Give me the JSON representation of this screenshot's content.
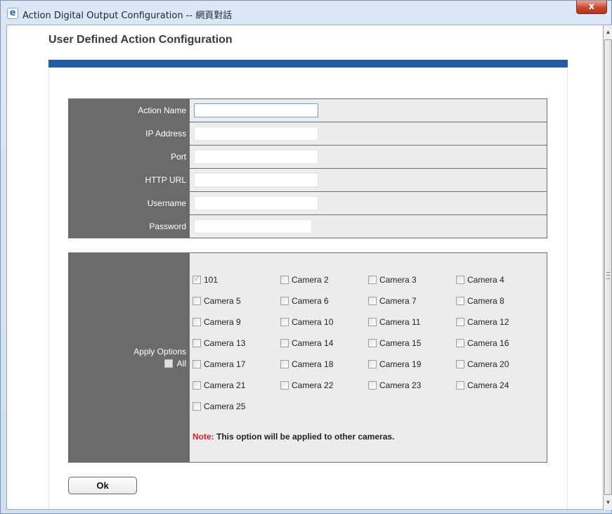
{
  "window": {
    "title": "Action Digital Output Configuration -- 網頁對話",
    "close_label": "x"
  },
  "page": {
    "heading": "User Defined Action Configuration"
  },
  "form": {
    "fields": [
      {
        "label": "Action Name",
        "value": ""
      },
      {
        "label": "IP Address",
        "value": ""
      },
      {
        "label": "Port",
        "value": ""
      },
      {
        "label": "HTTP URL",
        "value": ""
      },
      {
        "label": "Username",
        "value": ""
      },
      {
        "label": "Password",
        "value": ""
      }
    ]
  },
  "apply_options": {
    "label": "Apply Options",
    "all_label": "All",
    "all_checked": false,
    "cameras": [
      {
        "label": "101",
        "checked": true,
        "disabled": true
      },
      {
        "label": "Camera 2",
        "checked": false
      },
      {
        "label": "Camera 3",
        "checked": false
      },
      {
        "label": "Camera 4",
        "checked": false
      },
      {
        "label": "Camera 5",
        "checked": false
      },
      {
        "label": "Camera 6",
        "checked": false
      },
      {
        "label": "Camera 7",
        "checked": false
      },
      {
        "label": "Camera 8",
        "checked": false
      },
      {
        "label": "Camera 9",
        "checked": false
      },
      {
        "label": "Camera 10",
        "checked": false
      },
      {
        "label": "Camera 11",
        "checked": false
      },
      {
        "label": "Camera 12",
        "checked": false
      },
      {
        "label": "Camera 13",
        "checked": false
      },
      {
        "label": "Camera 14",
        "checked": false
      },
      {
        "label": "Camera 15",
        "checked": false
      },
      {
        "label": "Camera 16",
        "checked": false
      },
      {
        "label": "Camera 17",
        "checked": false
      },
      {
        "label": "Camera 18",
        "checked": false
      },
      {
        "label": "Camera 19",
        "checked": false
      },
      {
        "label": "Camera 20",
        "checked": false
      },
      {
        "label": "Camera 21",
        "checked": false
      },
      {
        "label": "Camera 22",
        "checked": false
      },
      {
        "label": "Camera 23",
        "checked": false
      },
      {
        "label": "Camera 24",
        "checked": false
      },
      {
        "label": "Camera 25",
        "checked": false
      }
    ],
    "note_label": "Note:",
    "note_text": " This option will be applied to other cameras."
  },
  "buttons": {
    "ok_label": "Ok"
  },
  "colors": {
    "header_band": "#1f5ba8",
    "label_cell": "#6b6b6b",
    "note_red": "#e02020"
  }
}
